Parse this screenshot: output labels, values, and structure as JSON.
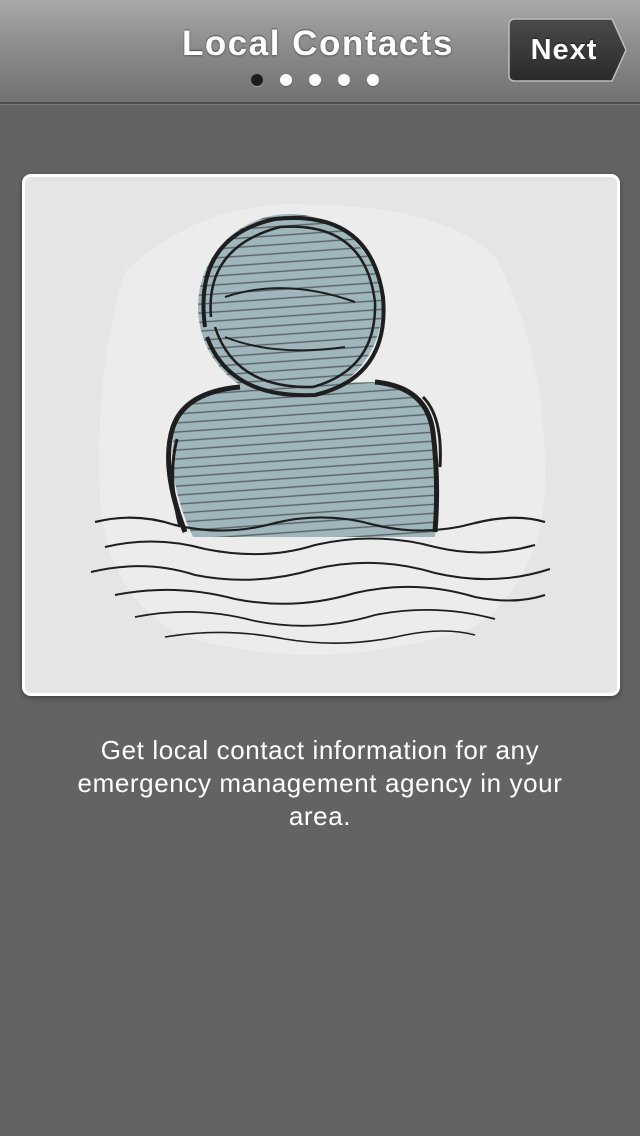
{
  "navbar": {
    "title": "Local Contacts",
    "next_label": "Next",
    "page_indicator": {
      "total": 5,
      "current": 1
    }
  },
  "illustration": {
    "icon": "person-in-floodwater-sketch",
    "colors": {
      "figure_fill": "#9fb6bd",
      "ink": "#1e1e1e",
      "background": "#e5e5e5"
    }
  },
  "description": "Get local contact information for any emergency management agency in your area."
}
